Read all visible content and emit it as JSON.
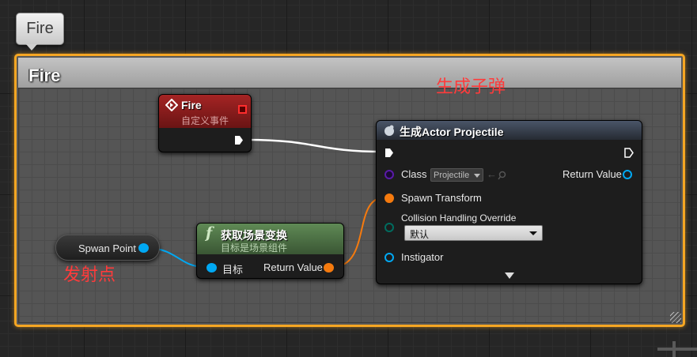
{
  "tag_label": "Fire",
  "comment": {
    "title": "Fire",
    "annotation_spawn": "生成子弹",
    "annotation_point": "发射点"
  },
  "fire_event": {
    "title": "Fire",
    "subtitle": "自定义事件"
  },
  "spawn_actor": {
    "title": "生成Actor Projectile",
    "class_label": "Class",
    "class_value": "Projectile",
    "return_value_label": "Return Value",
    "spawn_transform_label": "Spawn Transform",
    "collision_label": "Collision Handling Override",
    "collision_value": "默认",
    "instigator_label": "Instigator"
  },
  "get_transform": {
    "title": "获取场景变换",
    "subtitle": "目标是场景组件",
    "target_label": "目标",
    "return_value_label": "Return Value"
  },
  "variable": {
    "label": "Spwan Point"
  },
  "colors": {
    "comment_border": "#f5a623",
    "annotation": "#ff3b3b",
    "object_pin": "#00a8f3",
    "transform_pin": "#f57a0e",
    "class_pin": "#5a1aa8",
    "byte_pin": "#006c5f",
    "event_header": "#8b1a1a",
    "function_header": "#4b6b45"
  }
}
